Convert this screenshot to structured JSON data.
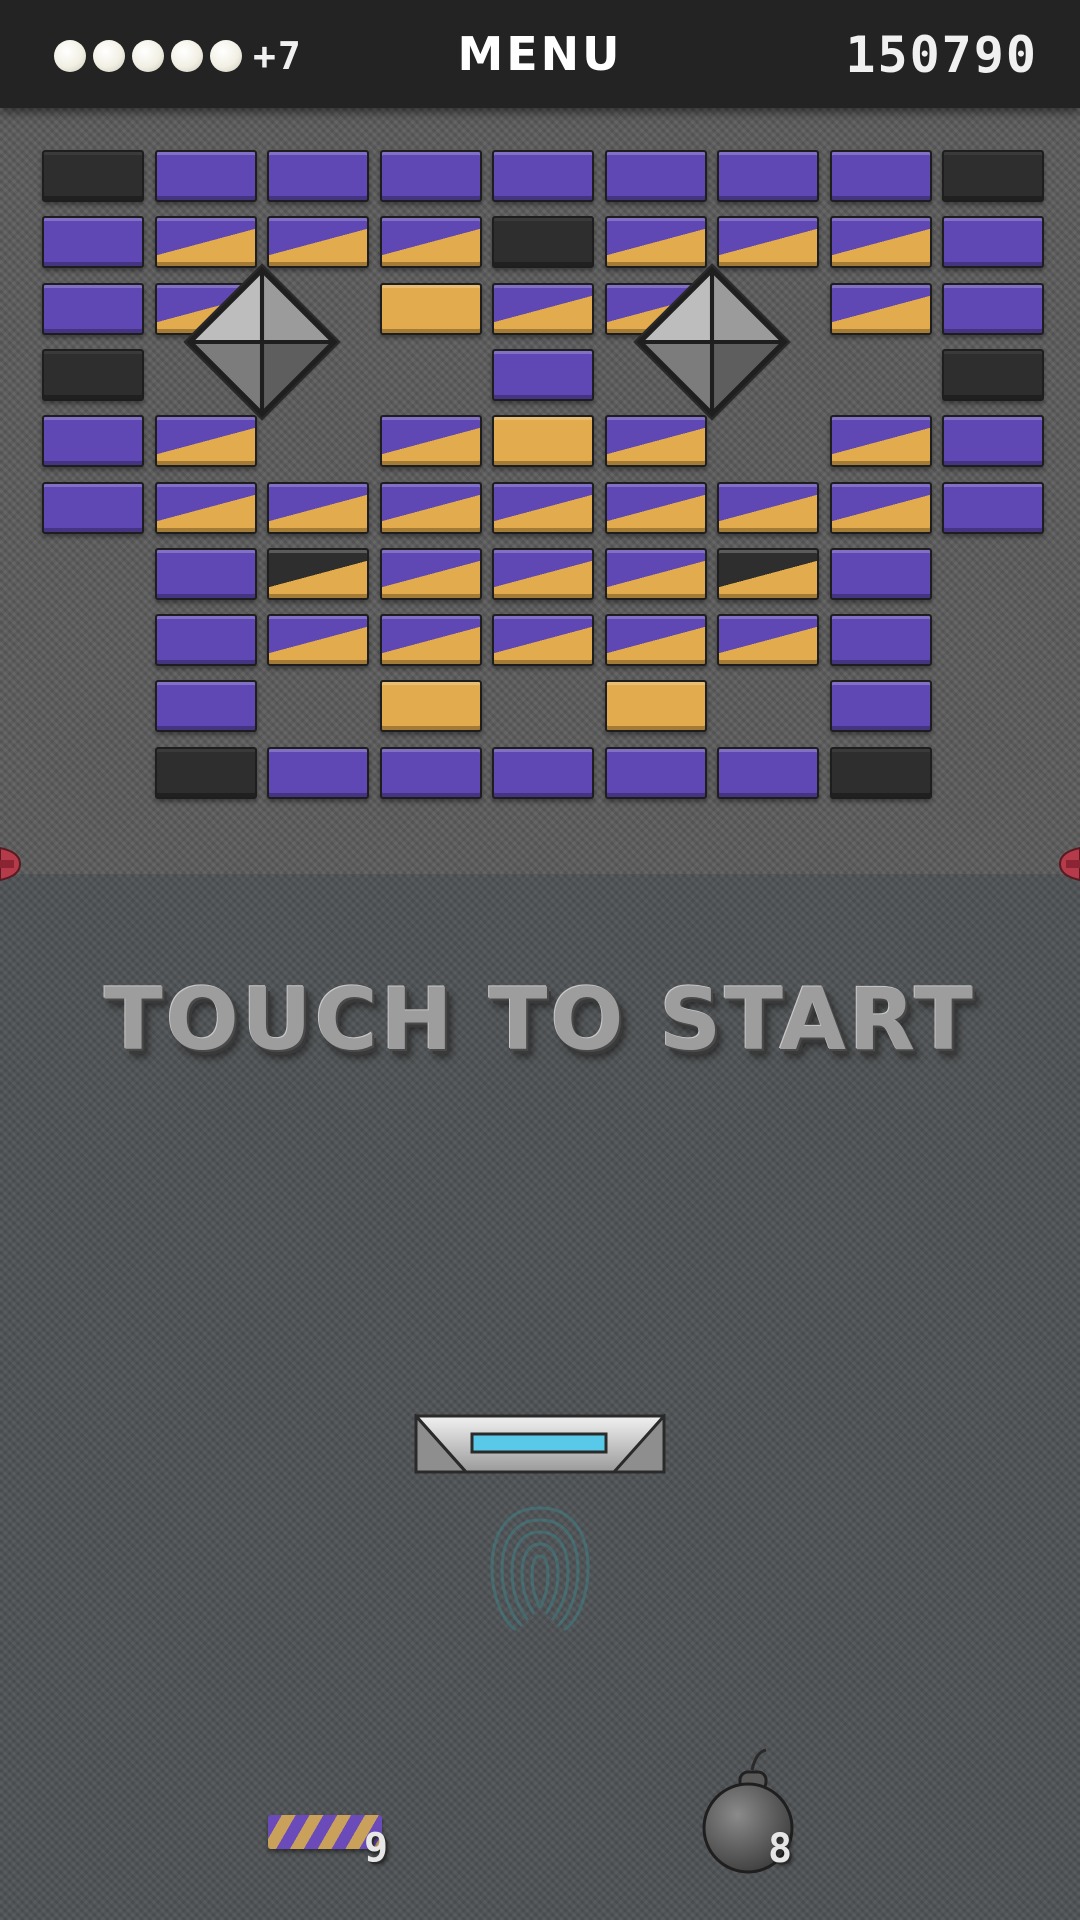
{
  "hud": {
    "lives_balls": 5,
    "lives_extra": "+7",
    "menu_label": "MENU",
    "score": "150790"
  },
  "message": "TOUCH TO START",
  "bricks": {
    "colors": {
      "purple": "#5f48b4",
      "gold": "#e2ab4d",
      "black": "#2e2e2e",
      "steel": "#8a8a8a"
    },
    "rows": [
      [
        "black",
        "purple",
        "purple",
        "purple",
        "purple",
        "purple",
        "purple",
        "purple",
        "black"
      ],
      [
        "purple",
        "purple-gold",
        "purple-gold",
        "purple-gold",
        "black",
        "purple-gold",
        "purple-gold",
        "purple-gold",
        "purple"
      ],
      [
        "purple",
        "purple-gold",
        "",
        "gold",
        "purple-gold",
        "purple-gold",
        "",
        "purple-gold",
        "purple"
      ],
      [
        "black",
        "",
        "",
        "",
        "purple",
        "",
        "",
        "",
        "black"
      ],
      [
        "purple",
        "purple-gold",
        "",
        "purple-gold",
        "gold",
        "purple-gold",
        "",
        "purple-gold",
        "purple"
      ],
      [
        "purple",
        "purple-gold",
        "purple-gold",
        "purple-gold",
        "purple-gold",
        "purple-gold",
        "purple-gold",
        "purple-gold",
        "purple"
      ],
      [
        "",
        "purple",
        "black-gold",
        "purple-gold",
        "purple-gold",
        "purple-gold",
        "black-gold",
        "purple",
        ""
      ],
      [
        "",
        "purple",
        "purple-gold",
        "purple-gold",
        "purple-gold",
        "purple-gold",
        "purple-gold",
        "purple",
        ""
      ],
      [
        "",
        "purple",
        "",
        "gold",
        "",
        "gold",
        "",
        "purple",
        ""
      ],
      [
        "",
        "black",
        "purple",
        "purple",
        "purple",
        "purple",
        "purple",
        "black",
        ""
      ]
    ],
    "studs": [
      {
        "row": 2,
        "col": 1.5
      },
      {
        "row": 2,
        "col": 5.5
      }
    ]
  },
  "powerups": {
    "laser_count": "9",
    "bomb_count": "8"
  }
}
